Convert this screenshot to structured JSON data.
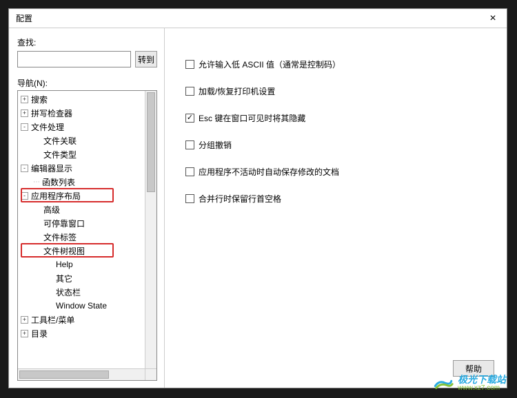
{
  "dialog": {
    "title": "配置",
    "close_icon": "×"
  },
  "search": {
    "label": "查找:",
    "value": "",
    "goto_label": "转到"
  },
  "nav": {
    "label": "导航(N):"
  },
  "tree": {
    "items": [
      {
        "label": "搜索",
        "level": 0,
        "expander": "+"
      },
      {
        "label": "拼写检查器",
        "level": 0,
        "expander": "+"
      },
      {
        "label": "文件处理",
        "level": 0,
        "expander": "-"
      },
      {
        "label": "文件关联",
        "level": 1,
        "leaf": true
      },
      {
        "label": "文件类型",
        "level": 1,
        "leaf": true
      },
      {
        "label": "编辑器显示",
        "level": 0,
        "expander": "-"
      },
      {
        "label": "函数列表",
        "level": 1,
        "dots": true
      },
      {
        "label": "应用程序布局",
        "level": 0,
        "expander": "-",
        "highlight": "a"
      },
      {
        "label": "高级",
        "level": 1,
        "leaf": true
      },
      {
        "label": "可停靠窗口",
        "level": 1,
        "leaf": true
      },
      {
        "label": "文件标签",
        "level": 1,
        "leaf": true
      },
      {
        "label": "文件树视图",
        "level": 1,
        "leaf": true,
        "highlight": "b"
      },
      {
        "label": "Help",
        "level": 2,
        "leaf": true
      },
      {
        "label": "其它",
        "level": 2,
        "leaf": true
      },
      {
        "label": "状态栏",
        "level": 2,
        "leaf": true
      },
      {
        "label": "Window State",
        "level": 2,
        "leaf": true
      },
      {
        "label": "工具栏/菜单",
        "level": 0,
        "expander": "+"
      },
      {
        "label": "目录",
        "level": 0,
        "expander": "+"
      }
    ]
  },
  "options": [
    {
      "label": "允许输入低 ASCII 值（通常是控制码）",
      "checked": false
    },
    {
      "label": "加载/恢复打印机设置",
      "checked": false
    },
    {
      "label": "Esc 键在窗口可见时将其隐藏",
      "checked": true
    },
    {
      "label": "分组撤销",
      "checked": false
    },
    {
      "label": "应用程序不活动时自动保存修改的文档",
      "checked": false
    },
    {
      "label": "合并行时保留行首空格",
      "checked": false
    }
  ],
  "buttons": {
    "help": "帮助"
  },
  "watermark": {
    "line1": "极光下载站",
    "line2": "www.xz7.com"
  }
}
